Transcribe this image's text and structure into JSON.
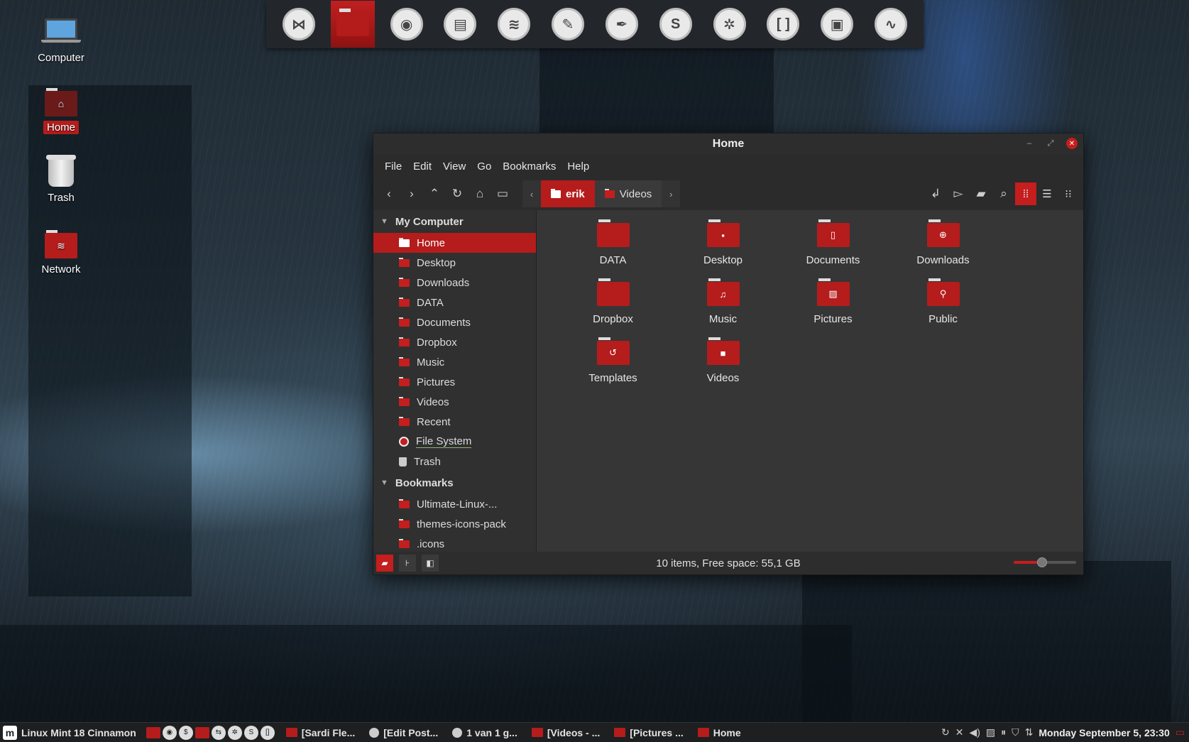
{
  "dock": {
    "items": [
      {
        "name": "bow-tie",
        "glyph": "⋈",
        "active": false
      },
      {
        "name": "files",
        "glyph": "",
        "active": true
      },
      {
        "name": "firefox",
        "glyph": "◉",
        "active": false
      },
      {
        "name": "document-viewer",
        "glyph": "▤",
        "active": false
      },
      {
        "name": "spotify",
        "glyph": "≋",
        "active": false
      },
      {
        "name": "gimp",
        "glyph": "✎",
        "active": false
      },
      {
        "name": "inkscape",
        "glyph": "✒",
        "active": false
      },
      {
        "name": "skype",
        "glyph": "S",
        "active": false
      },
      {
        "name": "settings",
        "glyph": "✲",
        "active": false
      },
      {
        "name": "brackets",
        "glyph": "[ ]",
        "active": false
      },
      {
        "name": "image-editor",
        "glyph": "▣",
        "active": false
      },
      {
        "name": "system-monitor",
        "glyph": "∿",
        "active": false
      }
    ]
  },
  "desktop": {
    "computer": "Computer",
    "home": "Home",
    "trash": "Trash",
    "network": "Network"
  },
  "window": {
    "title": "Home",
    "menu": [
      "File",
      "Edit",
      "View",
      "Go",
      "Bookmarks",
      "Help"
    ],
    "path": {
      "active": "erik",
      "next": "Videos"
    },
    "sidebar": {
      "section_computer": "My Computer",
      "items": [
        "Home",
        "Desktop",
        "Downloads",
        "DATA",
        "Documents",
        "Dropbox",
        "Music",
        "Pictures",
        "Videos",
        "Recent",
        "File System",
        "Trash"
      ],
      "section_bookmarks": "Bookmarks",
      "bookmarks": [
        "Ultimate-Linux-...",
        "themes-icons-pack",
        ".icons"
      ]
    },
    "files": [
      {
        "name": "DATA",
        "glyph": ""
      },
      {
        "name": "Desktop",
        "glyph": "▪"
      },
      {
        "name": "Documents",
        "glyph": "▯"
      },
      {
        "name": "Downloads",
        "glyph": "⊕"
      },
      {
        "name": "Dropbox",
        "glyph": ""
      },
      {
        "name": "Music",
        "glyph": "♫"
      },
      {
        "name": "Pictures",
        "glyph": "▨"
      },
      {
        "name": "Public",
        "glyph": "⚲"
      },
      {
        "name": "Templates",
        "glyph": "↺"
      },
      {
        "name": "Videos",
        "glyph": "■"
      }
    ],
    "status": "10 items, Free space: 55,1 GB",
    "zoom_level": 0.45
  },
  "taskbar": {
    "start": "Linux Mint 18 Cinnamon",
    "windows": [
      "[Sardi Fle...",
      "[Edit Post...",
      "1 van 1 g...",
      "[Videos - ...",
      "[Pictures ...",
      "Home"
    ],
    "clock": "Monday September  5, 23:30"
  },
  "colors": {
    "accent": "#b51c1c",
    "window_bg": "#363636",
    "sidebar_bg": "#303030"
  }
}
